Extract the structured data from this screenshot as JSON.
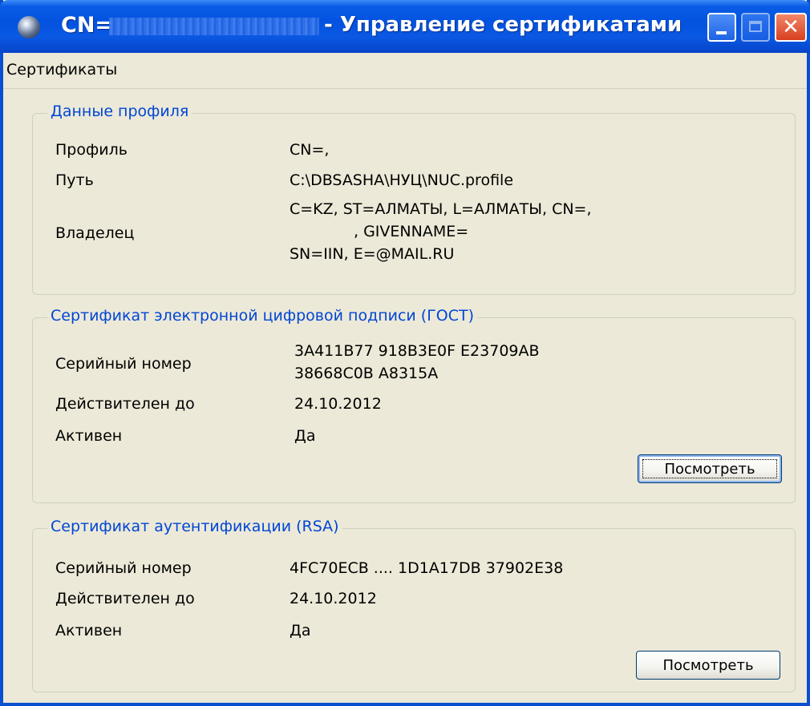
{
  "window": {
    "title_prefix": "CN=",
    "title_suffix": "- Управление сертификатами"
  },
  "menu": {
    "certificates": "Сертификаты"
  },
  "profile": {
    "group_title": "Данные профиля",
    "profile_label": "Профиль",
    "profile_value": "CN=,",
    "path_label": "Путь",
    "path_value": "C:\\DBSASHA\\НУЦ\\NUC.profile",
    "owner_label": "Владелец",
    "owner_line1": "C=KZ, ST=АЛМАТЫ, L=АЛМАТЫ, CN=,",
    "owner_line2": ", GIVENNAME=",
    "owner_line3": "SN=IIN, E=@MAIL.RU"
  },
  "gost": {
    "group_title": "Сертификат электронной цифровой подписи (ГОСТ)",
    "serial_label": "Серийный номер",
    "serial_line1": "3A411B77 918B3E0F E23709AB",
    "serial_line2": "38668C0B A8315A",
    "valid_label": "Действителен до",
    "valid_value": "24.10.2012",
    "active_label": "Активен",
    "active_value": "Да",
    "view_button": "Посмотреть"
  },
  "rsa": {
    "group_title": "Сертификат аутентификации (RSA)",
    "serial_label": "Серийный номер",
    "serial_value": "4FC70ECB .... 1D1A17DB 37902E38",
    "valid_label": "Действителен до",
    "valid_value": "24.10.2012",
    "active_label": "Активен",
    "active_value": "Да",
    "view_button": "Посмотреть"
  },
  "colors": {
    "titlebar": "#0353e0",
    "window_bg": "#ece9d8",
    "group_title": "#0046d5"
  },
  "icons": {
    "app": "globe-icon",
    "minimize": "minimize-icon",
    "maximize": "maximize-icon",
    "close": "close-icon"
  }
}
